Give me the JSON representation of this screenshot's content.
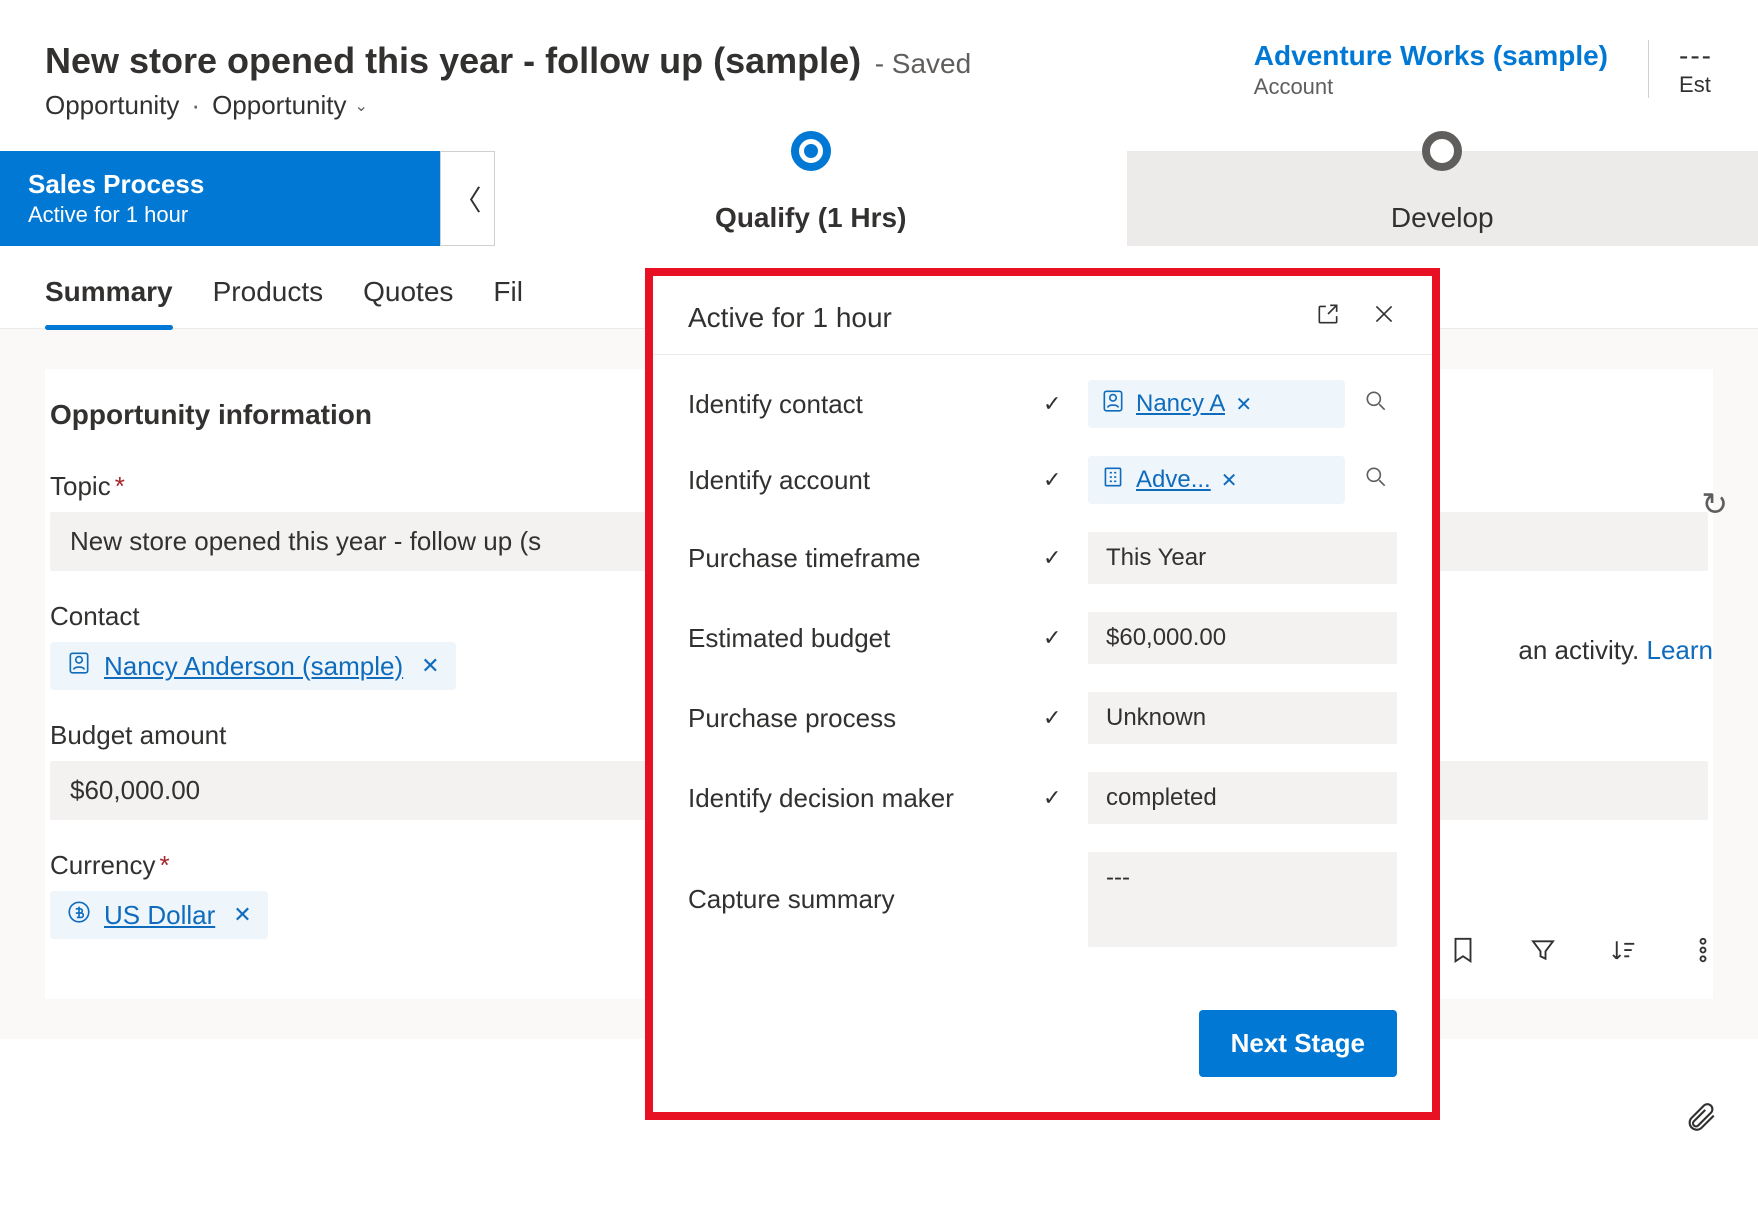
{
  "header": {
    "title": "New store opened this year - follow up (sample)",
    "saved": "- Saved",
    "entity": "Opportunity",
    "form": "Opportunity",
    "account_link": "Adventure Works (sample)",
    "account_label": "Account",
    "est_dash": "---",
    "est_label": "Est"
  },
  "bpf": {
    "process_name": "Sales Process",
    "process_status": "Active for 1 hour",
    "stages": {
      "qualify": "Qualify  (1 Hrs)",
      "develop": "Develop"
    }
  },
  "tabs": {
    "summary": "Summary",
    "products": "Products",
    "quotes": "Quotes",
    "files": "Fil"
  },
  "form": {
    "section_title": "Opportunity information",
    "topic_label": "Topic",
    "topic_value": "New store opened this year - follow up (s",
    "contact_label": "Contact",
    "contact_value": "Nancy Anderson (sample)",
    "budget_label": "Budget amount",
    "budget_value": "$60,000.00",
    "currency_label": "Currency",
    "currency_value": "US Dollar"
  },
  "right": {
    "activity_text": " an activity. ",
    "learn": "Learn"
  },
  "flyout": {
    "title": "Active for 1 hour",
    "rows": {
      "contact": {
        "label": "Identify contact",
        "value": "Nancy A"
      },
      "account": {
        "label": "Identify account",
        "value": "Adve..."
      },
      "timeframe": {
        "label": "Purchase timeframe",
        "value": "This Year"
      },
      "budget": {
        "label": "Estimated budget",
        "value": "$60,000.00"
      },
      "process": {
        "label": "Purchase process",
        "value": "Unknown"
      },
      "decision": {
        "label": "Identify decision maker",
        "value": "completed"
      },
      "summary": {
        "label": "Capture summary",
        "value": "---"
      }
    },
    "next_stage": "Next Stage"
  }
}
